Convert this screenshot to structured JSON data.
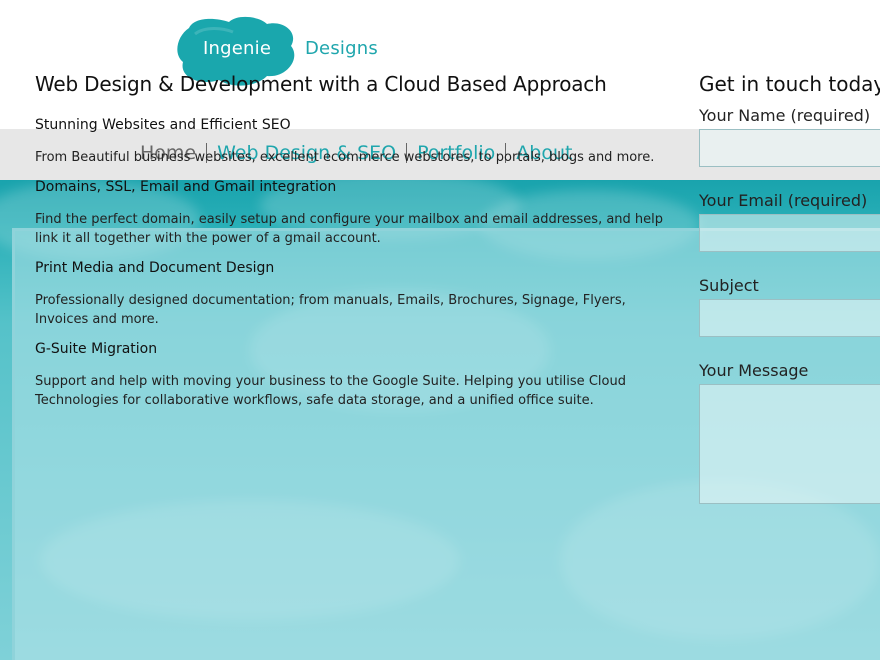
{
  "brand": {
    "name_part1": "Ingenie",
    "name_part2": "Designs",
    "accent_color": "#1fa6ad",
    "text_color_on_blob": "#ffffff"
  },
  "nav": {
    "items": [
      {
        "label": "Home",
        "active": true
      },
      {
        "label": "Web Design & SEO",
        "active": false
      },
      {
        "label": "Portfolio",
        "active": false
      },
      {
        "label": "About",
        "active": false
      }
    ]
  },
  "main": {
    "title": "Web Design & Development with a Cloud Based Approach",
    "services": [
      {
        "heading": "Stunning Websites and Efficient SEO",
        "text": "From Beautiful business websites, excellent ecommerce webstores, to portals, blogs and more."
      },
      {
        "heading": "Domains, SSL, Email and Gmail integration",
        "text": "Find the perfect domain, easily setup and configure your mailbox and email addresses, and help link it all together with the power of a gmail account."
      },
      {
        "heading": "Print Media and Document Design",
        "text": "Professionally designed documentation; from manuals, Emails, Brochures, Signage, Flyers, Invoices and more."
      },
      {
        "heading": "G-Suite Migration",
        "text": "Support and help with moving your business to the Google Suite. Helping you utilise Cloud Technologies for collaborative workflows, safe data storage, and a unified office suite."
      }
    ]
  },
  "contact": {
    "title": "Get in touch today",
    "fields": [
      {
        "label": "Your Name (required)",
        "value": ""
      },
      {
        "label": "Your Email (required)",
        "value": ""
      },
      {
        "label": "Subject",
        "value": ""
      },
      {
        "label": "Your Message",
        "value": ""
      }
    ]
  }
}
